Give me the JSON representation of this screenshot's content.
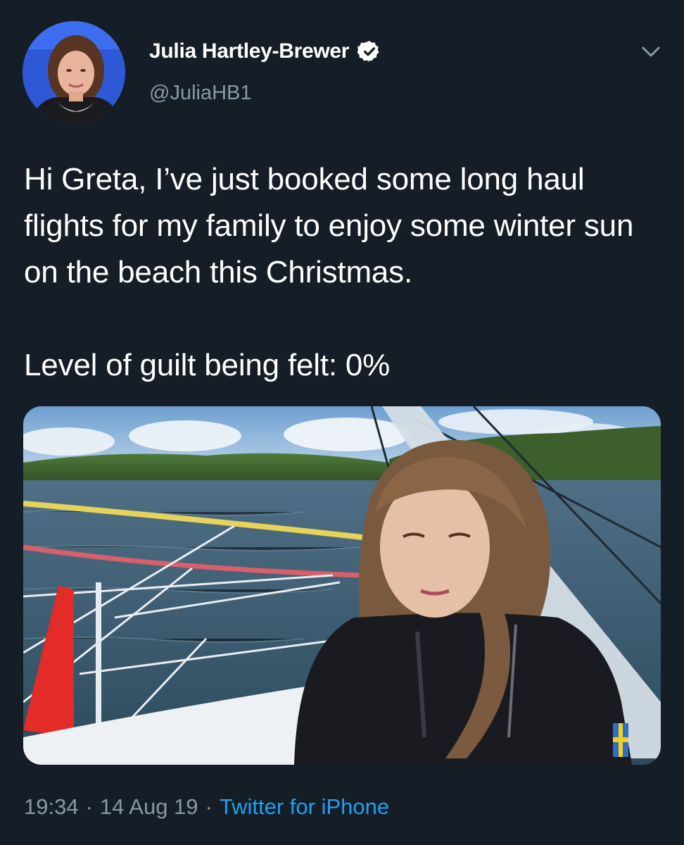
{
  "author": {
    "display_name": "Julia Hartley-Brewer",
    "handle": "@JuliaHB1",
    "verified": true,
    "avatar_icon": "profile-photo"
  },
  "tweet": {
    "text": "Hi Greta, I’ve just booked some long haul flights for my family to enjoy some winter sun on the beach this Christmas.\n\nLevel of guilt being felt: 0%"
  },
  "media": {
    "type": "photo",
    "icon": "photo-girl-on-sailboat"
  },
  "meta": {
    "time": "19:34",
    "separator": "·",
    "date": "14 Aug 19",
    "source": "Twitter for iPhone"
  },
  "colors": {
    "background": "#151d26",
    "text_primary": "#ffffff",
    "text_secondary": "#8899a6",
    "link": "#1da1f2"
  }
}
